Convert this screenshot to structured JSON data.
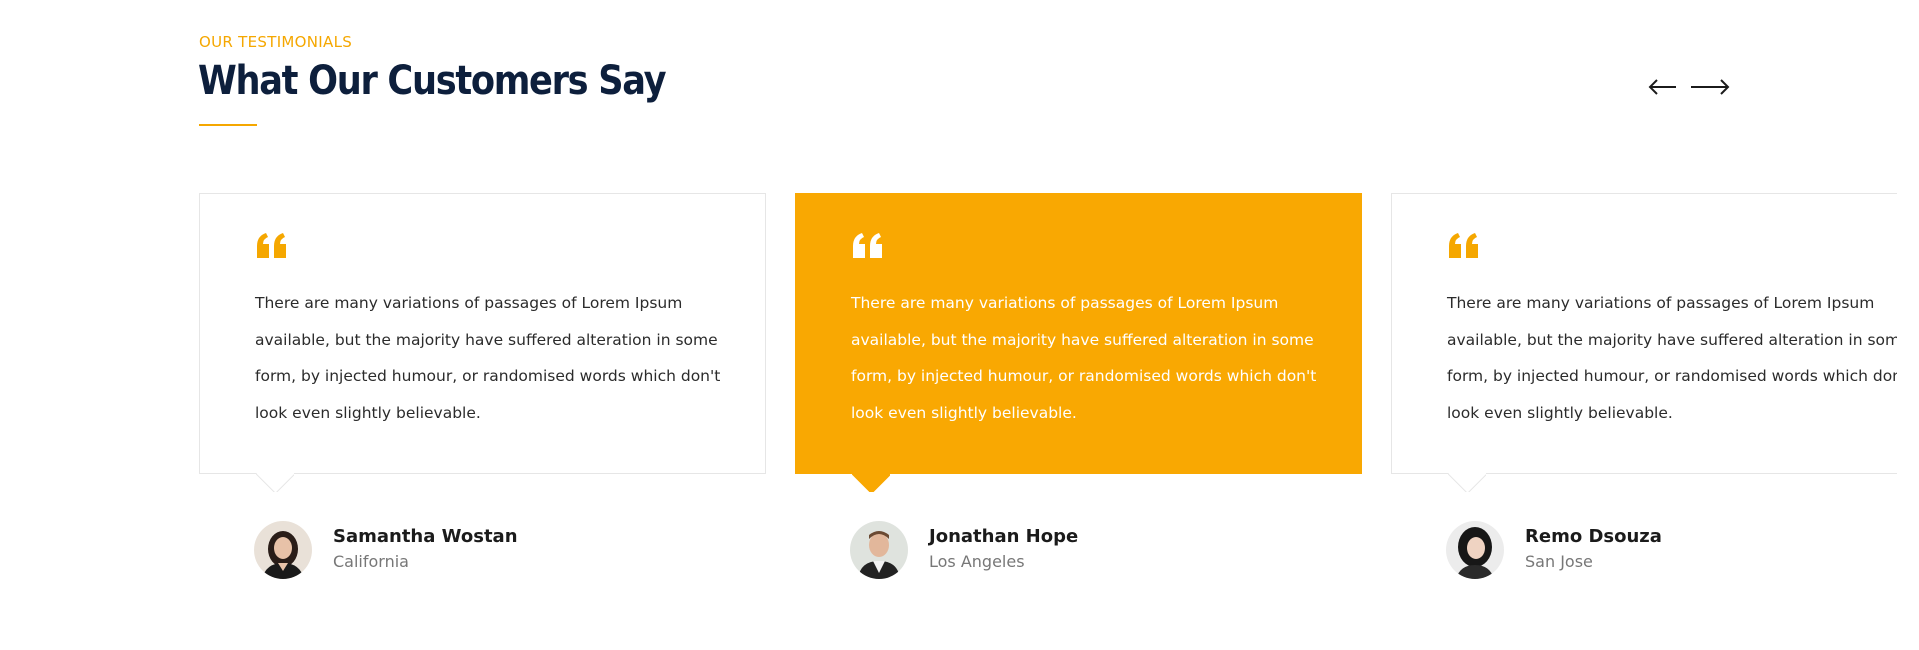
{
  "section": {
    "eyebrow": "OUR TESTIMONIALS",
    "title": "What Our Customers Say",
    "accent_color": "#f5a700",
    "title_color": "#0d1f3c"
  },
  "nav": {
    "prev_icon": "arrow-left-icon",
    "next_icon": "arrow-right-icon"
  },
  "testimonials": [
    {
      "text": "There are many variations of passages of Lorem Ipsum available, but the majority have suffered alteration in some form, by injected humour, or randomised words which don't look even slightly believable.",
      "name": "Samantha Wostan",
      "location": "California",
      "active": false
    },
    {
      "text": "There are many variations of passages of Lorem Ipsum available, but the majority have suffered alteration in some form, by injected humour, or randomised words which don't look even slightly believable.",
      "name": "Jonathan Hope",
      "location": "Los Angeles",
      "active": true
    },
    {
      "text": "There are many variations of passages of Lorem Ipsum available, but the majority have suffered alteration in some form, by injected humour, or randomised words which don't look even slightly believable.",
      "name": "Remo Dsouza",
      "location": "San Jose",
      "active": false
    }
  ],
  "active_card_color": "#f9a802"
}
